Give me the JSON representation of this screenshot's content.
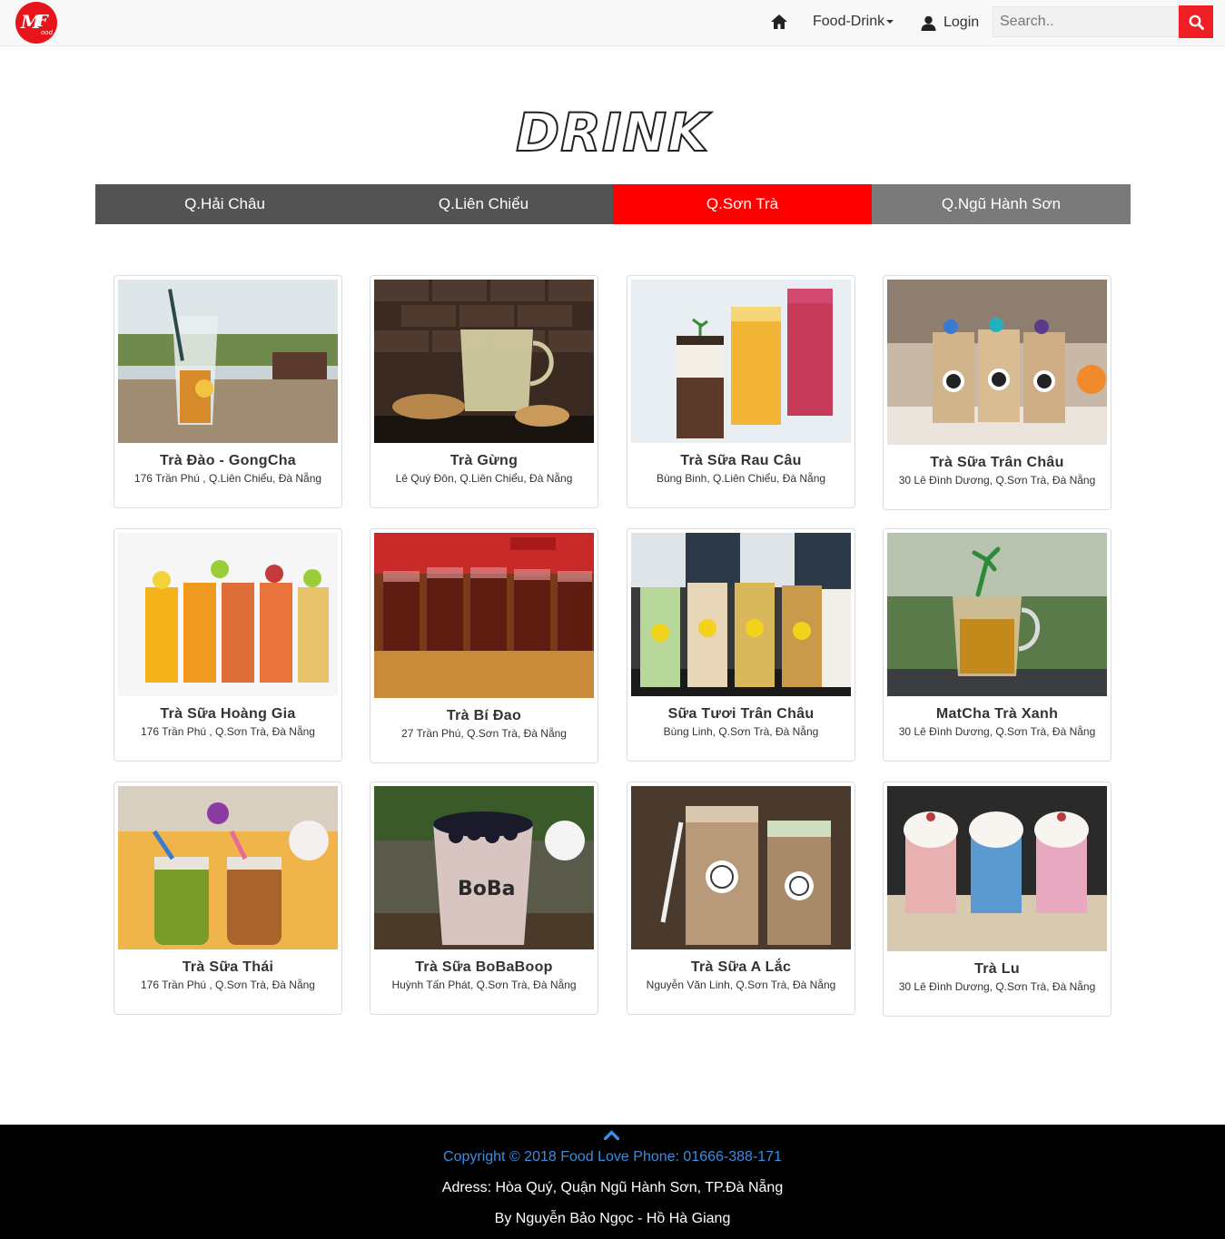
{
  "nav": {
    "logo_text": "MFood",
    "home_icon": "home-icon",
    "food_drink_label": "Food-Drink",
    "login_label": "Login",
    "search_placeholder": "Search..",
    "search_icon": "search-icon"
  },
  "page": {
    "title": "DRINK"
  },
  "tabs": [
    {
      "label": "Q.Hải Châu"
    },
    {
      "label": "Q.Liên Chiểu"
    },
    {
      "label": "Q.Sơn Trà"
    },
    {
      "label": "Q.Ngũ Hành Sơn"
    }
  ],
  "colors": {
    "accent": "#ff0000",
    "tab_dark": "#535353",
    "tab_light": "#7a7a7a",
    "footer_bg": "#000000",
    "footer_link": "#3b8de0"
  },
  "items": [
    {
      "name": "Trà Đào - GongCha",
      "address": "176 Trần Phú , Q.Liên Chiểu, Đà Nẵng"
    },
    {
      "name": "Trà Gừng",
      "address": "Lê Quý Đôn, Q.Liên Chiểu, Đà Nẵng"
    },
    {
      "name": "Trà Sữa Rau Câu",
      "address": "Bùng Binh, Q.Liên Chiểu, Đà Nẵng"
    },
    {
      "name": "Trà Sữa Trân Châu",
      "address": "30 Lê Đình Dương, Q.Sơn Trà, Đà Nẵng"
    },
    {
      "name": "Trà Sữa Hoàng Gia",
      "address": "176 Trần Phú , Q.Sơn Trà, Đà Nẵng"
    },
    {
      "name": "Trà Bí Đao",
      "address": "27 Trần Phú, Q.Sơn Trà, Đà Nẵng"
    },
    {
      "name": "Sữa Tươi Trân Châu",
      "address": "Bùng Linh, Q.Sơn Trà, Đà Nẵng"
    },
    {
      "name": "MatCha Trà Xanh",
      "address": "30 Lê Đình Dương, Q.Sơn Trà, Đà Nẵng"
    },
    {
      "name": "Trà Sữa Thái",
      "address": "176 Trần Phú , Q.Sơn Trà, Đà Nẵng"
    },
    {
      "name": "Trà Sữa BoBaBoop",
      "address": "Huỳnh Tấn Phát, Q.Sơn Trà, Đà Nẵng"
    },
    {
      "name": "Trà Sữa A Lắc",
      "address": "Nguyễn Văn Linh, Q.Sơn Trà, Đà Nẵng"
    },
    {
      "name": "Trà Lu",
      "address": "30 Lê Đình Dương, Q.Sơn Trà, Đà Nẵng"
    }
  ],
  "footer": {
    "to_top_icon": "chevron-up-icon",
    "copyright": "Copyright © 2018 Food Love Phone: 01666-388-171",
    "address": "Adress: Hòa Quý, Quận Ngũ Hành Sơn, TP.Đà Nẵng",
    "by": "By Nguyễn Bảo Ngọc - Hồ Hà Giang"
  }
}
